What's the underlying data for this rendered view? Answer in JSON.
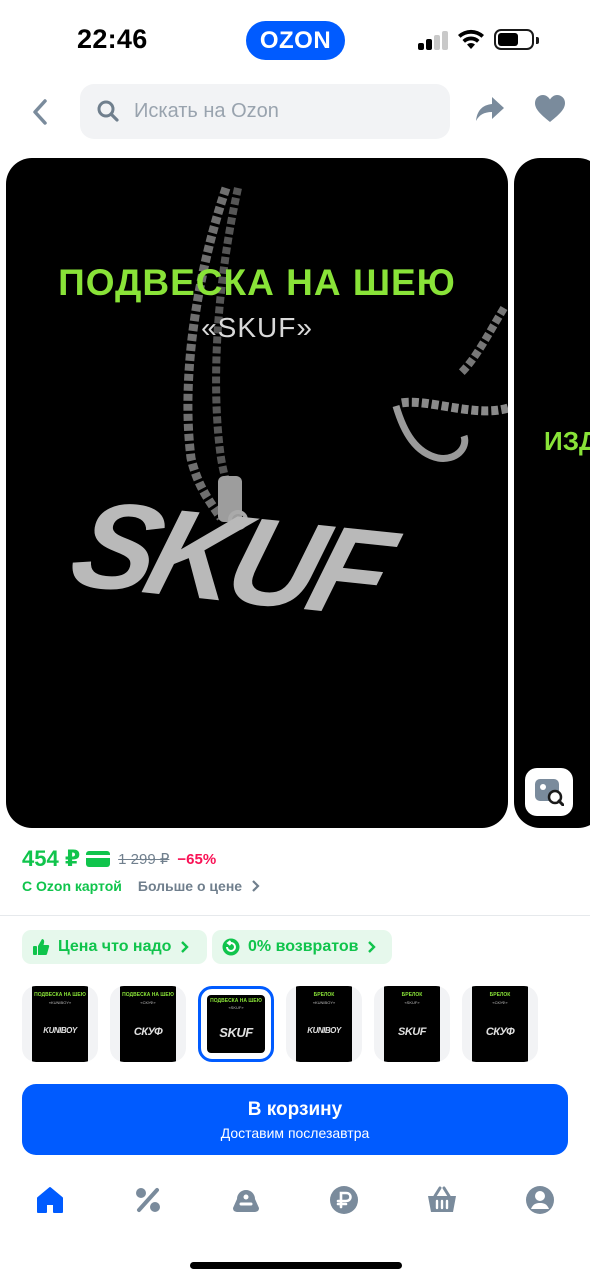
{
  "status_bar": {
    "time": "22:46",
    "brand": "OZON"
  },
  "header": {
    "search_placeholder": "Искать на Ozon"
  },
  "gallery": {
    "title": "ПОДВЕСКА НА ШЕЮ",
    "subtitle": "«SKUF»",
    "pendant_text": "SKUF",
    "next_title": "ИЗД"
  },
  "price": {
    "current": "454 ₽",
    "old": "1 299 ₽",
    "discount": "−65%",
    "card_label": "С Ozon картой",
    "more_label": "Больше о цене"
  },
  "badges": [
    {
      "label": "Цена что надо"
    },
    {
      "label": "0% возвратов"
    }
  ],
  "thumbnails": [
    {
      "caption": "ПОДВЕСКА НА ШЕЮ",
      "sub": "«KUNIBOY»",
      "word": "KUNIBOY"
    },
    {
      "caption": "ПОДВЕСКА НА ШЕЮ",
      "sub": "«СКУФ»",
      "word": "СКУФ"
    },
    {
      "caption": "ПОДВЕСКА НА ШЕЮ",
      "sub": "«SKUF»",
      "word": "SKUF"
    },
    {
      "caption": "БРЕЛОК",
      "sub": "«KUNIBOY»",
      "word": "KUNIBOY"
    },
    {
      "caption": "БРЕЛОК",
      "sub": "«SKUF»",
      "word": "SKUF"
    },
    {
      "caption": "БРЕЛОК",
      "sub": "«СКУФ»",
      "word": "СКУФ"
    }
  ],
  "cart": {
    "label": "В корзину",
    "sub": "Доставим послезавтра"
  },
  "colors": {
    "accent": "#005bff",
    "price_green": "#10c44c",
    "promo_green": "#89e338",
    "discount_pink": "#f91155"
  },
  "tabbar": [
    "home-icon",
    "percent-icon",
    "fresh-icon",
    "ruble-icon",
    "cart-icon",
    "profile-icon"
  ]
}
